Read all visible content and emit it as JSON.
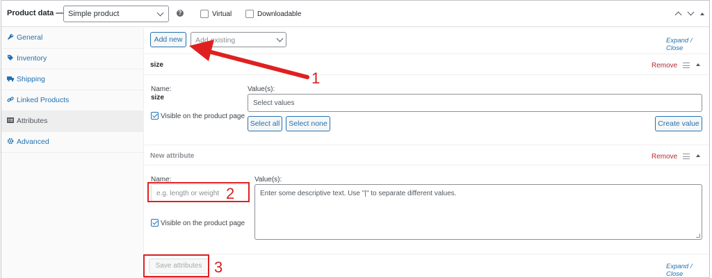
{
  "header": {
    "title": "Product data —",
    "product_type": "Simple product",
    "help": "?",
    "virtual_label": "Virtual",
    "downloadable_label": "Downloadable"
  },
  "sidebar": {
    "items": [
      {
        "label": "General",
        "icon": "wrench-icon",
        "active": false
      },
      {
        "label": "Inventory",
        "icon": "tag-icon",
        "active": false
      },
      {
        "label": "Shipping",
        "icon": "truck-icon",
        "active": false
      },
      {
        "label": "Linked Products",
        "icon": "link-icon",
        "active": false
      },
      {
        "label": "Attributes",
        "icon": "list-icon",
        "active": true
      },
      {
        "label": "Advanced",
        "icon": "gear-icon",
        "active": false
      }
    ]
  },
  "toolbar": {
    "add_new_label": "Add new",
    "add_existing_placeholder": "Add existing",
    "expand_close": "Expand / Close"
  },
  "attribute_size": {
    "title": "size",
    "remove_label": "Remove",
    "name_label": "Name:",
    "name_value": "size",
    "values_label": "Value(s):",
    "values_placeholder": "Select values",
    "visible_label": "Visible on the product page",
    "select_all": "Select all",
    "select_none": "Select none",
    "create_value": "Create value"
  },
  "attribute_new": {
    "title": "New attribute",
    "remove_label": "Remove",
    "name_label": "Name:",
    "name_placeholder": "e.g. length or weight",
    "values_label": "Value(s):",
    "values_placeholder": "Enter some descriptive text. Use \"|\" to separate different values.",
    "visible_label": "Visible on the product page"
  },
  "footer": {
    "save_label": "Save attributes",
    "expand_close": "Expand / Close"
  },
  "annotations": {
    "n1": "1",
    "n2": "2",
    "n3": "3"
  },
  "colors": {
    "accent": "#2271b1",
    "remove": "#b32d2e",
    "annotation": "#e02020"
  }
}
